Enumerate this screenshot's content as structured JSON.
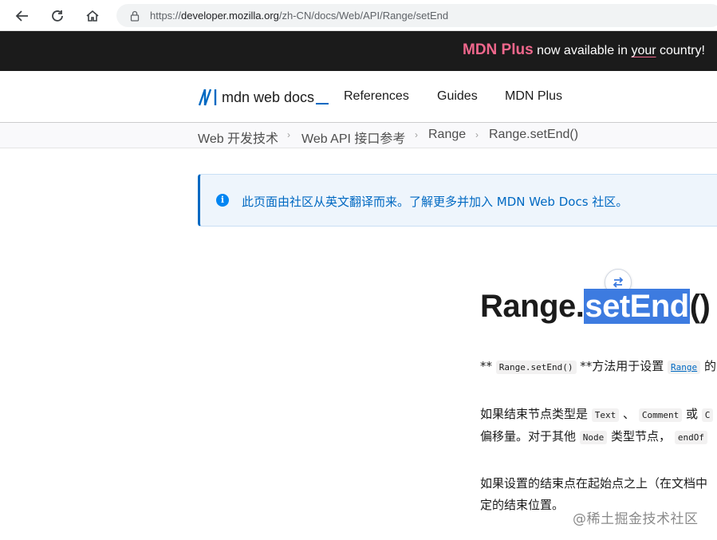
{
  "browser": {
    "url_scheme": "https://",
    "url_host": "developer.mozilla.org",
    "url_path": "/zh-CN/docs/Web/API/Range/setEnd"
  },
  "banner": {
    "brand": "MDN Plus",
    "text_1": " now available in ",
    "text_your": "your",
    "text_2": " country!"
  },
  "header": {
    "logo_text": "mdn web docs",
    "menu": [
      "References",
      "Guides",
      "MDN Plus"
    ]
  },
  "breadcrumbs": [
    "Web 开发技术",
    "Web API 接口参考",
    "Range",
    "Range.setEnd()"
  ],
  "notice": {
    "text": "此页面由社区从英文翻译而来。了解更多并加入 MDN Web Docs 社区。"
  },
  "article": {
    "title_prefix": "Range.",
    "title_selected": "setEnd",
    "title_suffix": "()",
    "p1": {
      "t1": "** ",
      "code1": "Range.setEnd()",
      "t2": " **方法用于设置 ",
      "code_link": "Range",
      "t3": " 的"
    },
    "p2_line1": {
      "t1": "如果结束节点类型是 ",
      "code1": "Text",
      "t2": " 、 ",
      "code2": "Comment",
      "t3": " 或 ",
      "code3": "C"
    },
    "p2_line2": {
      "t1": "偏移量。对于其他 ",
      "code1": "Node",
      "t2": " 类型节点， ",
      "code2": "endOf"
    },
    "p3_line1": "如果设置的结束点在起始点之上（在文档中",
    "p3_line2": "定的结束位置。"
  },
  "watermark": "@稀土掘金技术社区",
  "colors": {
    "accent": "#0069c2",
    "banner_brand": "#f0678c",
    "selection": "#3d7be0"
  }
}
